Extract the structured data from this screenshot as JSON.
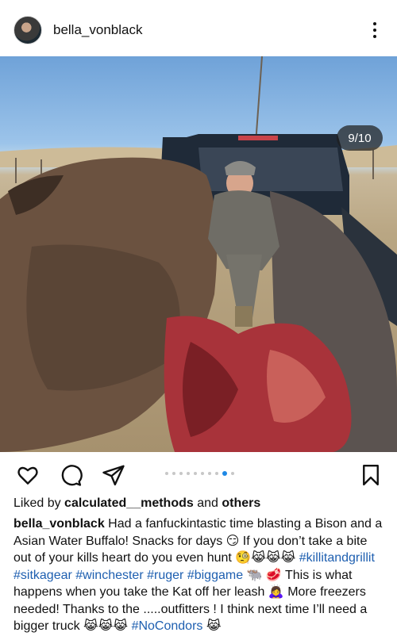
{
  "post": {
    "username": "bella_vonblack",
    "image_counter": "9/10",
    "carousel": {
      "count": 10,
      "active_index": 8
    },
    "liked_by_prefix": "Liked by",
    "liked_by_user": "calculated__methods",
    "liked_by_and": "and",
    "liked_by_others": "others",
    "caption": {
      "author": "bella_vonblack",
      "text_1": "Had a fanfuckintastic time blasting a Bison and a Asian Water Buffalo! Snacks for days 😏  If you don’t take a bite out of your kills heart do you even hunt 🧐😹😹😹",
      "tags_1": [
        "#killitandgrillit",
        "#sitkagear",
        "#winchester",
        "#ruger",
        "#biggame"
      ],
      "text_2": "🐃 🥩 This is what happens when you take the Kat off her leash 🙇‍♀️ More freezers needed! Thanks to the .....outfitters ! I think next time I’ll need a bigger truck 😹😹😹",
      "tag_2": "#NoCondors",
      "text_3": "😹"
    }
  },
  "icons": {
    "avatar": "profile-avatar",
    "more": "more-options-icon",
    "like": "heart-icon",
    "comment": "comment-icon",
    "share": "send-icon",
    "save": "bookmark-icon"
  },
  "colors": {
    "hashtag": "#1e5fb0",
    "active_dot": "#1e88e5"
  }
}
